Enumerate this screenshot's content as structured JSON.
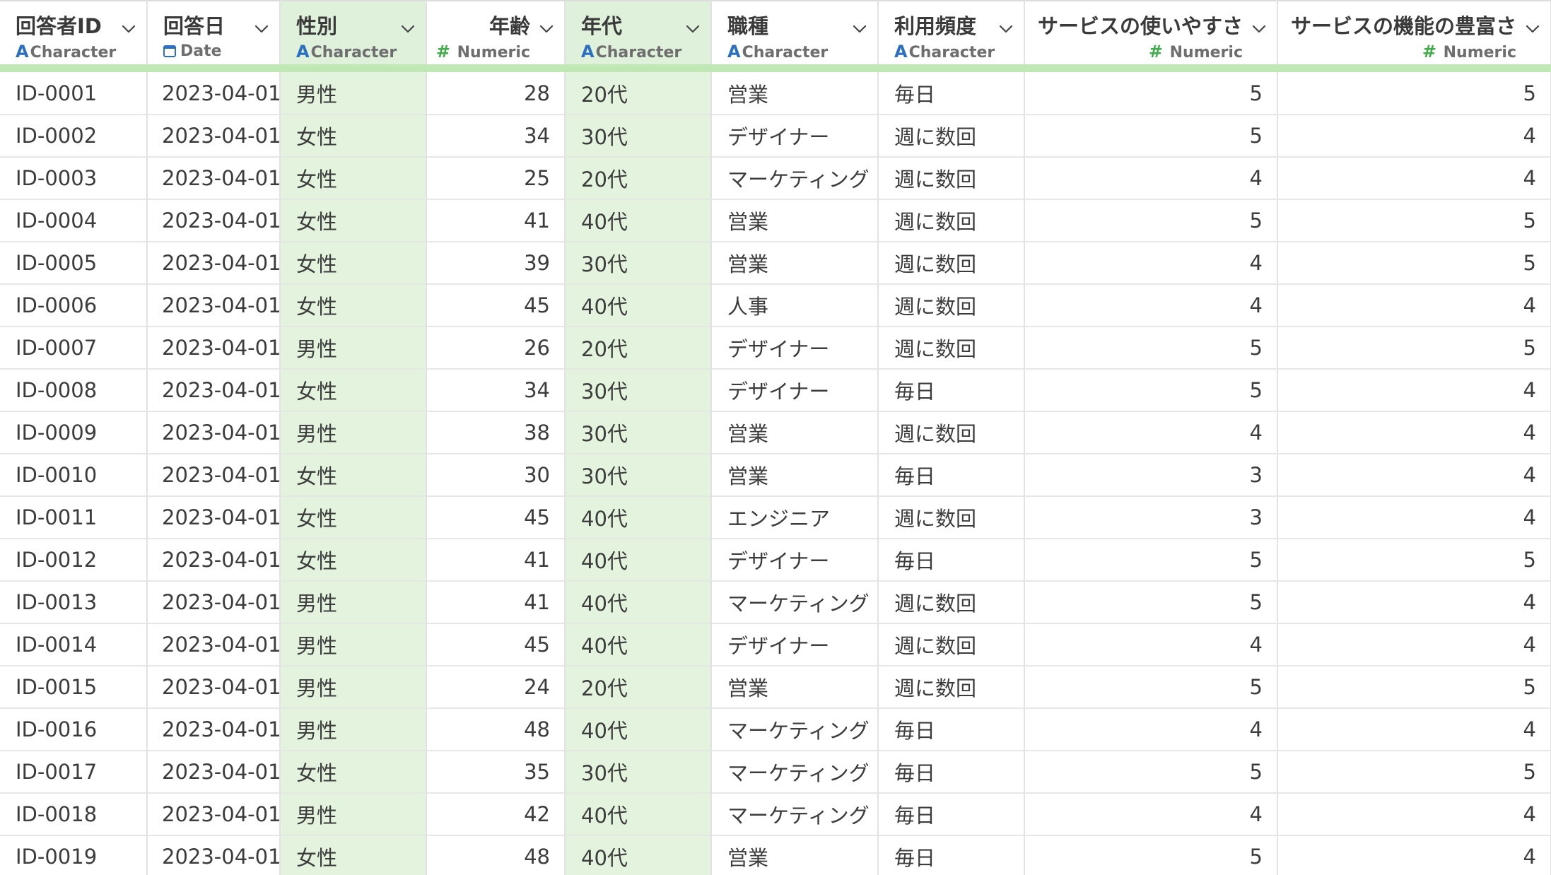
{
  "columns": [
    {
      "name": "回答者ID",
      "type": "Character",
      "kind": "char",
      "selected": false,
      "align": "left"
    },
    {
      "name": "回答日",
      "type": "Date",
      "kind": "date",
      "selected": false,
      "align": "left"
    },
    {
      "name": "性別",
      "type": "Character",
      "kind": "char",
      "selected": true,
      "align": "left"
    },
    {
      "name": "年齢",
      "type": "Numeric",
      "kind": "num",
      "selected": false,
      "align": "right"
    },
    {
      "name": "年代",
      "type": "Character",
      "kind": "char",
      "selected": true,
      "align": "left"
    },
    {
      "name": "職種",
      "type": "Character",
      "kind": "char",
      "selected": false,
      "align": "left"
    },
    {
      "name": "利用頻度",
      "type": "Character",
      "kind": "char",
      "selected": false,
      "align": "left"
    },
    {
      "name": "サービスの使いやすさ",
      "type": "Numeric",
      "kind": "num",
      "selected": false,
      "align": "right"
    },
    {
      "name": "サービスの機能の豊富さ",
      "type": "Numeric",
      "kind": "num",
      "selected": false,
      "align": "right"
    }
  ],
  "type_glyphs": {
    "char": "A",
    "num": "#",
    "date": "calendar-icon"
  },
  "colors": {
    "selected_column_bg": "#e3f3de",
    "header_accent": "#bfe8b4",
    "char_glyph": "#2b6fc0",
    "numeric_glyph": "#3fae4a"
  },
  "rows": [
    [
      "ID-0001",
      "2023-04-01",
      "男性",
      "28",
      "20代",
      "営業",
      "毎日",
      "5",
      "5"
    ],
    [
      "ID-0002",
      "2023-04-01",
      "女性",
      "34",
      "30代",
      "デザイナー",
      "週に数回",
      "5",
      "4"
    ],
    [
      "ID-0003",
      "2023-04-01",
      "女性",
      "25",
      "20代",
      "マーケティング",
      "週に数回",
      "4",
      "4"
    ],
    [
      "ID-0004",
      "2023-04-01",
      "女性",
      "41",
      "40代",
      "営業",
      "週に数回",
      "5",
      "5"
    ],
    [
      "ID-0005",
      "2023-04-01",
      "女性",
      "39",
      "30代",
      "営業",
      "週に数回",
      "4",
      "5"
    ],
    [
      "ID-0006",
      "2023-04-01",
      "女性",
      "45",
      "40代",
      "人事",
      "週に数回",
      "4",
      "4"
    ],
    [
      "ID-0007",
      "2023-04-01",
      "男性",
      "26",
      "20代",
      "デザイナー",
      "週に数回",
      "5",
      "5"
    ],
    [
      "ID-0008",
      "2023-04-01",
      "女性",
      "34",
      "30代",
      "デザイナー",
      "毎日",
      "5",
      "4"
    ],
    [
      "ID-0009",
      "2023-04-01",
      "男性",
      "38",
      "30代",
      "営業",
      "週に数回",
      "4",
      "4"
    ],
    [
      "ID-0010",
      "2023-04-01",
      "女性",
      "30",
      "30代",
      "営業",
      "毎日",
      "3",
      "4"
    ],
    [
      "ID-0011",
      "2023-04-01",
      "女性",
      "45",
      "40代",
      "エンジニア",
      "週に数回",
      "3",
      "4"
    ],
    [
      "ID-0012",
      "2023-04-01",
      "女性",
      "41",
      "40代",
      "デザイナー",
      "毎日",
      "5",
      "5"
    ],
    [
      "ID-0013",
      "2023-04-01",
      "男性",
      "41",
      "40代",
      "マーケティング",
      "週に数回",
      "5",
      "4"
    ],
    [
      "ID-0014",
      "2023-04-01",
      "男性",
      "45",
      "40代",
      "デザイナー",
      "週に数回",
      "4",
      "4"
    ],
    [
      "ID-0015",
      "2023-04-01",
      "男性",
      "24",
      "20代",
      "営業",
      "週に数回",
      "5",
      "5"
    ],
    [
      "ID-0016",
      "2023-04-01",
      "男性",
      "48",
      "40代",
      "マーケティング",
      "毎日",
      "4",
      "4"
    ],
    [
      "ID-0017",
      "2023-04-01",
      "女性",
      "35",
      "30代",
      "マーケティング",
      "毎日",
      "5",
      "5"
    ],
    [
      "ID-0018",
      "2023-04-01",
      "男性",
      "42",
      "40代",
      "マーケティング",
      "毎日",
      "4",
      "4"
    ],
    [
      "ID-0019",
      "2023-04-01",
      "女性",
      "48",
      "40代",
      "営業",
      "毎日",
      "5",
      "4"
    ]
  ]
}
